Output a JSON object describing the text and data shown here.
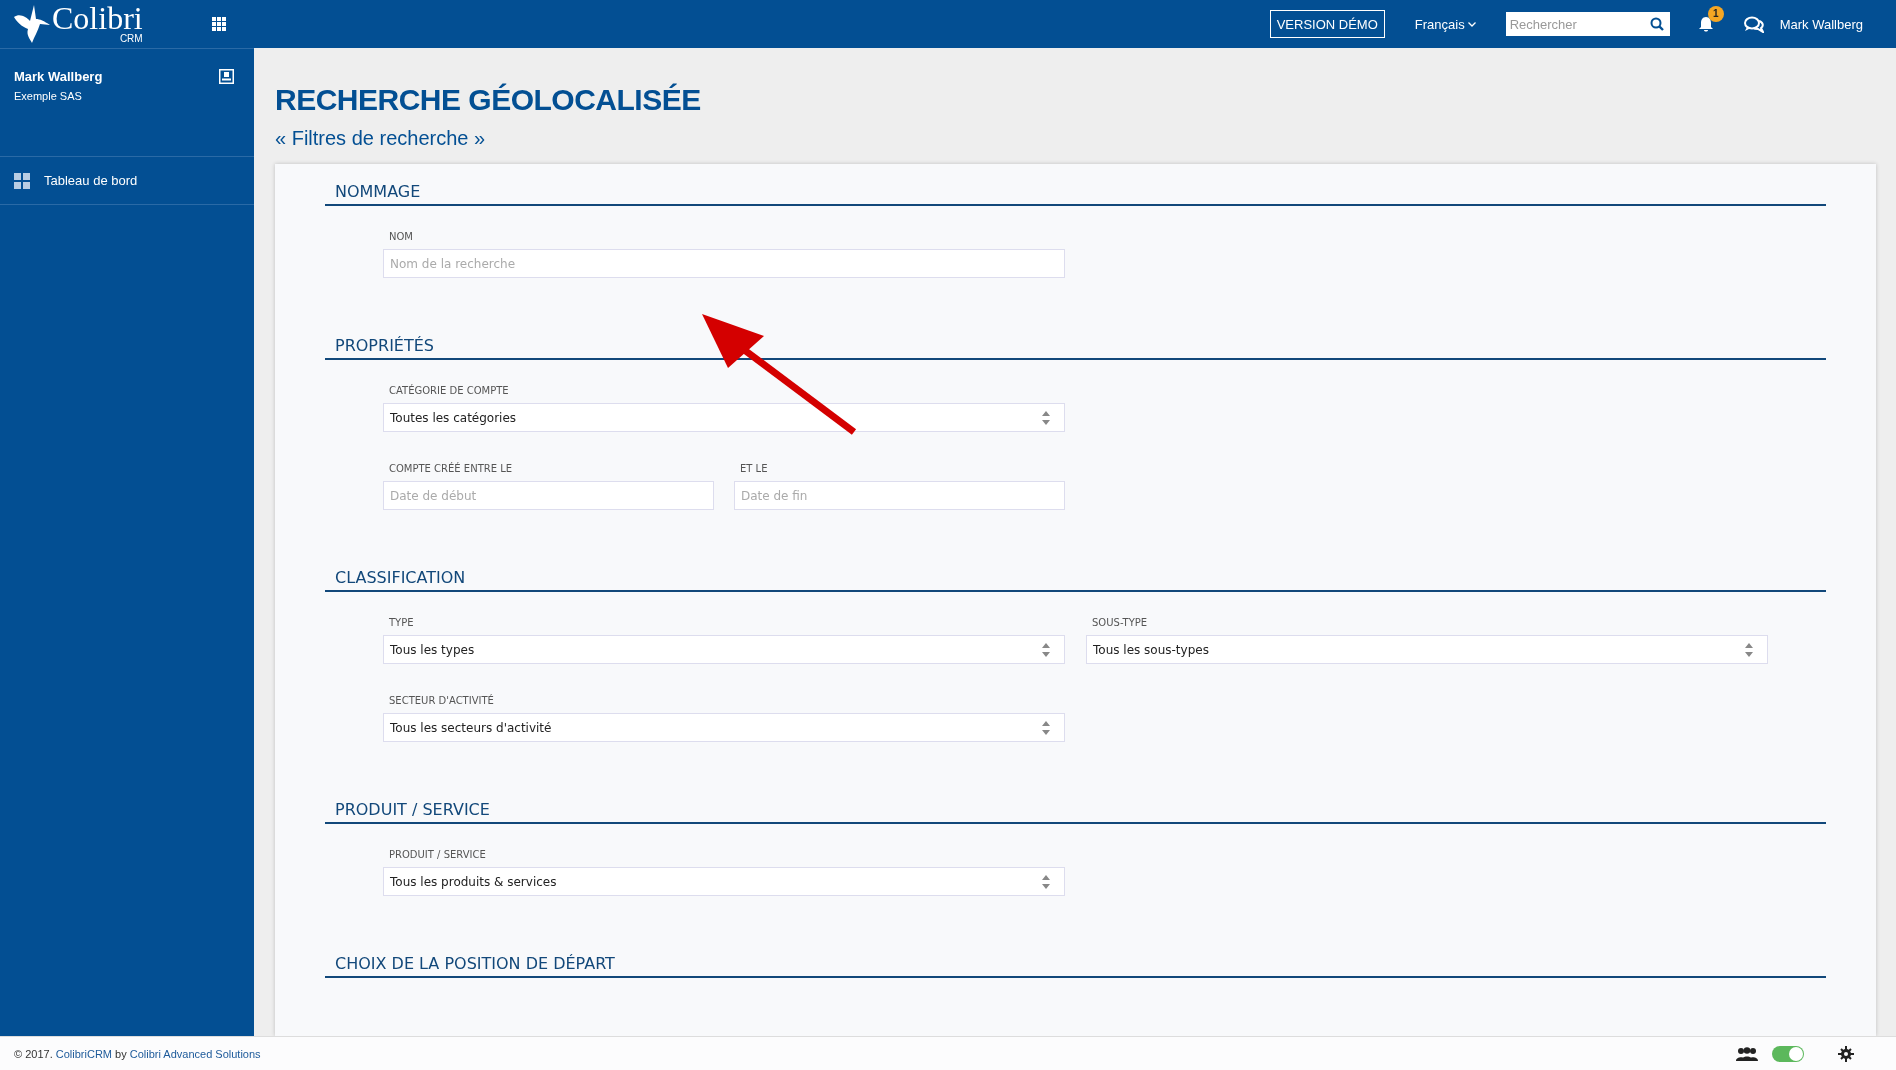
{
  "topbar": {
    "logo": "Colibri",
    "logo_sub": "CRM",
    "demo_button": "VERSION DÉMO",
    "language": "Français",
    "search": {
      "placeholder": "Rechercher"
    },
    "notification_count": "1",
    "user": "Mark Wallberg"
  },
  "sidebar": {
    "user": {
      "name": "Mark Wallberg",
      "company": "Exemple SAS"
    },
    "items": [
      {
        "label": "Tableau de bord"
      }
    ]
  },
  "page": {
    "title": "RECHERCHE GÉOLOCALISÉE",
    "subtitle": "« Filtres de recherche »"
  },
  "sections": [
    {
      "title": "NOMMAGE",
      "rows": [
        [
          {
            "kind": "text",
            "label": "NOM",
            "placeholder": "Nom de la recherche"
          }
        ]
      ]
    },
    {
      "title": "PROPRIÉTÉS",
      "rows": [
        [
          {
            "kind": "select",
            "label": "CATÉGORIE DE COMPTE",
            "value": "Toutes les catégories"
          }
        ],
        [
          {
            "kind": "date",
            "label": "COMPTE CRÉÉ ENTRE LE",
            "placeholder": "Date de début"
          },
          {
            "kind": "date",
            "label": "ET LE",
            "placeholder": "Date de fin"
          }
        ]
      ]
    },
    {
      "title": "CLASSIFICATION",
      "rows": [
        [
          {
            "kind": "select",
            "label": "TYPE",
            "value": "Tous les types"
          },
          {
            "kind": "select",
            "label": "SOUS-TYPE",
            "value": "Tous les sous-types"
          }
        ],
        [
          {
            "kind": "select",
            "label": "SECTEUR D'ACTIVITÉ",
            "value": "Tous les secteurs d'activité"
          }
        ]
      ]
    },
    {
      "title": "PRODUIT / SERVICE",
      "rows": [
        [
          {
            "kind": "select",
            "label": "PRODUIT / SERVICE",
            "value": "Tous les produits & services"
          }
        ]
      ]
    },
    {
      "title": "CHOIX DE LA POSITION DE DÉPART"
    }
  ],
  "footer": {
    "prefix": "© 2017.",
    "link": "ColibriCRM",
    "middle": "by",
    "company": "Colibri Advanced Solutions",
    "toggle": {
      "on": true
    }
  }
}
